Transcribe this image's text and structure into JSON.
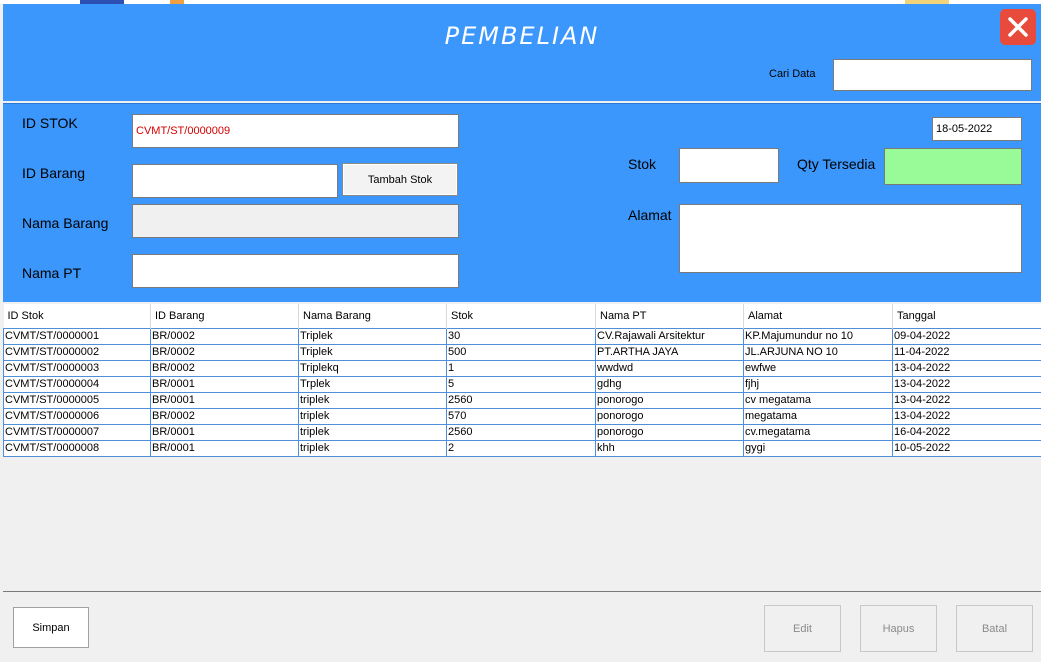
{
  "title": "PEMBELIAN",
  "search": {
    "label": "Cari Data",
    "value": ""
  },
  "form": {
    "id_stok_label": "ID STOK",
    "id_stok_value": "CVMT/ST/0000009",
    "id_barang_label": "ID Barang",
    "id_barang_value": "",
    "tambah_stok_label": "Tambah Stok",
    "nama_barang_label": "Nama Barang",
    "nama_barang_value": "",
    "nama_pt_label": "Nama PT",
    "nama_pt_value": "",
    "date_value": "18-05-2022",
    "stok_label": "Stok",
    "stok_value": "",
    "qty_label": "Qty Tersedia",
    "qty_value": "",
    "alamat_label": "Alamat",
    "alamat_value": ""
  },
  "table": {
    "headers": [
      "ID Stok",
      "ID Barang",
      "Nama Barang",
      "Stok",
      "Nama PT",
      "Alamat",
      "Tanggal"
    ],
    "rows": [
      [
        "CVMT/ST/0000001",
        "BR/0002",
        "Triplek",
        "30",
        "CV.Rajawali Arsitektur",
        "KP.Majumundur no 10",
        "09-04-2022"
      ],
      [
        "CVMT/ST/0000002",
        "BR/0002",
        "Triplek",
        "500",
        "PT.ARTHA JAYA",
        "JL.ARJUNA NO 10",
        "11-04-2022"
      ],
      [
        "CVMT/ST/0000003",
        "BR/0002",
        "Triplekq",
        "1",
        "wwdwd",
        "ewfwe",
        "13-04-2022"
      ],
      [
        "CVMT/ST/0000004",
        "BR/0001",
        "Trplek",
        "5",
        "gdhg",
        "fjhj",
        "13-04-2022"
      ],
      [
        "CVMT/ST/0000005",
        "BR/0001",
        "triplek",
        "2560",
        "ponorogo",
        "cv megatama",
        "13-04-2022"
      ],
      [
        "CVMT/ST/0000006",
        "BR/0002",
        "triplek",
        "570",
        "ponorogo",
        "megatama",
        "13-04-2022"
      ],
      [
        "CVMT/ST/0000007",
        "BR/0001",
        "triplek",
        "2560",
        "ponorogo",
        "cv.megatama",
        "16-04-2022"
      ],
      [
        "CVMT/ST/0000008",
        "BR/0001",
        "triplek",
        "2",
        "khh",
        "gygi",
        "10-05-2022"
      ]
    ]
  },
  "buttons": {
    "simpan": "Simpan",
    "edit": "Edit",
    "hapus": "Hapus",
    "batal": "Batal"
  },
  "colors": {
    "header_blue": "#3b97fb",
    "close_red": "#e84b3c",
    "qty_green": "#98fb98",
    "id_red": "#d40000"
  },
  "icons": {
    "close": "close-icon"
  }
}
